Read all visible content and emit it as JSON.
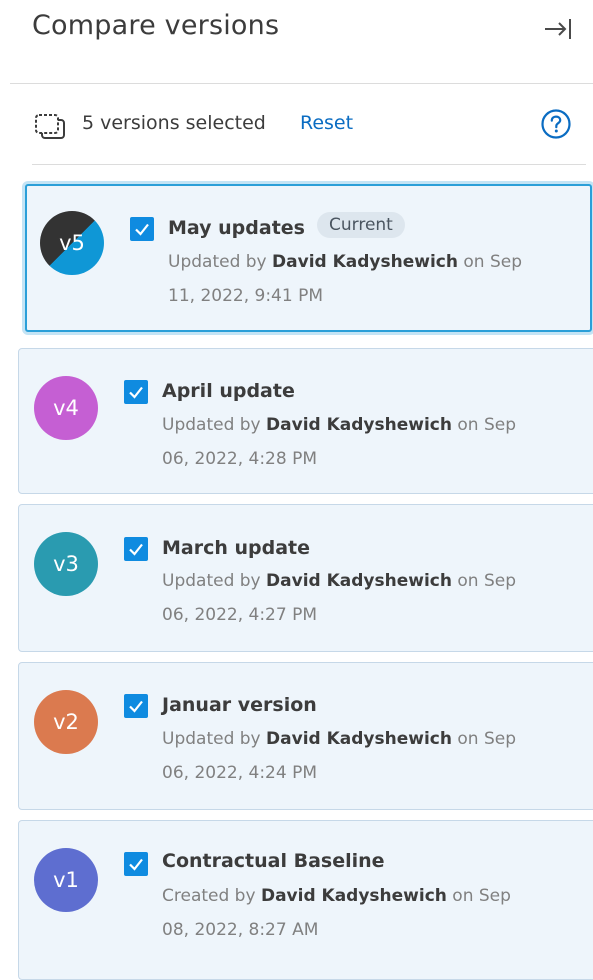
{
  "panel": {
    "title": "Compare versions",
    "collapse_icon": "collapse-right-icon"
  },
  "toolbar": {
    "compare_icon": "compare-versions-icon",
    "selected_text": "5 versions selected",
    "reset_label": "Reset",
    "help_icon": "help-icon"
  },
  "versions": [
    {
      "badge": "v5",
      "name": "May updates",
      "tag": "Current",
      "checked": true,
      "action": "Updated by",
      "user": "David Kadyshewich",
      "on": "on",
      "date_line1": "Sep",
      "date_line2": "11, 2022, 9:41 PM",
      "color": "#0f97d6"
    },
    {
      "badge": "v4",
      "name": "April update",
      "checked": true,
      "action": "Updated by",
      "user": "David Kadyshewich",
      "on": "on",
      "date_line1": "Sep",
      "date_line2": "06, 2022, 4:28 PM",
      "color": "#c55fd3"
    },
    {
      "badge": "v3",
      "name": "March update",
      "checked": true,
      "action": "Updated by",
      "user": "David Kadyshewich",
      "on": "on",
      "date_line1": "Sep",
      "date_line2": "06, 2022, 4:27 PM",
      "color": "#2a9bb0"
    },
    {
      "badge": "v2",
      "name": "Januar version",
      "checked": true,
      "action": "Updated by",
      "user": "David Kadyshewich",
      "on": "on",
      "date_line1": "Sep",
      "date_line2": "06, 2022, 4:24 PM",
      "color": "#db7a4f"
    },
    {
      "badge": "v1",
      "name": "Contractual Baseline",
      "checked": true,
      "action": "Created by",
      "user": "David Kadyshewich",
      "on": "on",
      "date_line1": "Sep",
      "date_line2": "08, 2022, 8:27 AM",
      "color": "#5e6ed0"
    }
  ],
  "colors": {
    "accent": "#0f8be0",
    "link": "#0a6cc2",
    "card_bg": "#eef5fb",
    "selected_border": "#2b9fd8"
  }
}
